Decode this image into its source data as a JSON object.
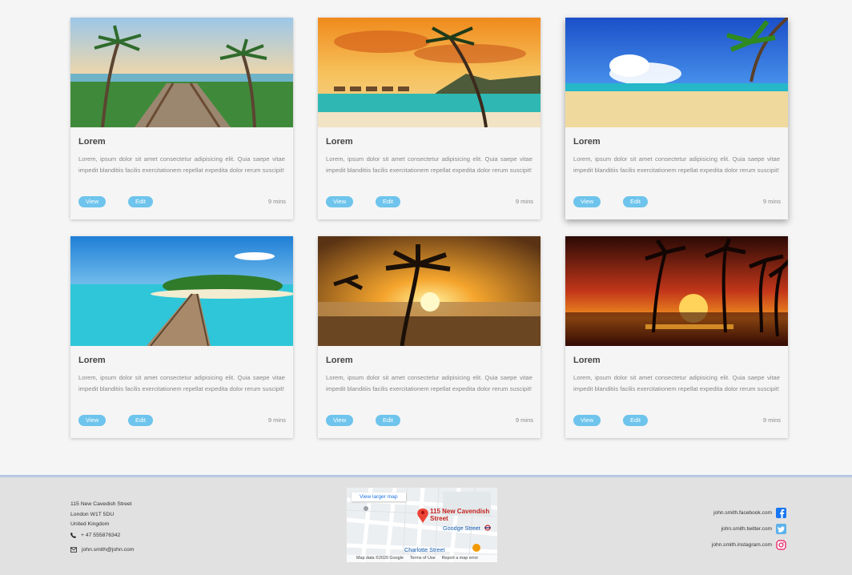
{
  "cards": [
    {
      "title": "Lorem",
      "text": "Lorem, ipsum dolor sit amet consectetur adipisicing elit. Quia saepe vitae impedit blanditiis facilis exercitationem repellat expedita dolor rerum suscipit!",
      "view_label": "View",
      "edit_label": "Edit",
      "time": "9 mins",
      "image": "beach-boardwalk-palms"
    },
    {
      "title": "Lorem",
      "text": "Lorem, ipsum dolor sit amet consectetur adipisicing elit. Quia saepe vitae impedit blanditiis facilis exercitationem repellat expedita dolor rerum suscipit!",
      "view_label": "View",
      "edit_label": "Edit",
      "time": "9 mins",
      "image": "sunset-overwater-bungalows"
    },
    {
      "title": "Lorem",
      "text": "Lorem, ipsum dolor sit amet consectetur adipisicing elit. Quia saepe vitae impedit blanditiis facilis exercitationem repellat expedita dolor rerum suscipit!",
      "view_label": "View",
      "edit_label": "Edit",
      "time": "9 mins",
      "image": "sandy-beach-blue-sky"
    },
    {
      "title": "Lorem",
      "text": "Lorem, ipsum dolor sit amet consectetur adipisicing elit. Quia saepe vitae impedit blanditiis facilis exercitationem repellat expedita dolor rerum suscipit!",
      "view_label": "View",
      "edit_label": "Edit",
      "time": "9 mins",
      "image": "island-jetty-turquoise"
    },
    {
      "title": "Lorem",
      "text": "Lorem, ipsum dolor sit amet consectetur adipisicing elit. Quia saepe vitae impedit blanditiis facilis exercitationem repellat expedita dolor rerum suscipit!",
      "view_label": "View",
      "edit_label": "Edit",
      "time": "9 mins",
      "image": "palm-sunset-beach"
    },
    {
      "title": "Lorem",
      "text": "Lorem, ipsum dolor sit amet consectetur adipisicing elit. Quia saepe vitae impedit blanditiis facilis exercitationem repellat expedita dolor rerum suscipit!",
      "view_label": "View",
      "edit_label": "Edit",
      "time": "9 mins",
      "image": "palm-silhouette-red-sunset"
    }
  ],
  "footer": {
    "address": [
      "115 New Cavedish Street",
      "London W1T 5DU",
      "United Kingdom"
    ],
    "phone": "+ 47 555876342",
    "email": "john.smith@john.com",
    "map": {
      "link": "View larger map",
      "place": "115 New Cavendish Street",
      "street1": "Goodge Street",
      "street2": "Charlotte Street",
      "google": "Google",
      "footer": [
        "Map data ©2020 Google",
        "Terms of Use",
        "Report a map error"
      ]
    },
    "social": [
      {
        "handle": "john.smith.facebook.com",
        "icon": "facebook-icon",
        "color": "#1877f2"
      },
      {
        "handle": "john.smith.twitter.com",
        "icon": "twitter-icon",
        "color": "#5bb2ea"
      },
      {
        "handle": "john.smith.instagram.com",
        "icon": "instagram-icon",
        "color": "#e1306c"
      }
    ]
  },
  "colors": {
    "button": "#6ec4ec",
    "footer_bg": "#e1e1e1",
    "footer_border": "#b7c7e6"
  }
}
